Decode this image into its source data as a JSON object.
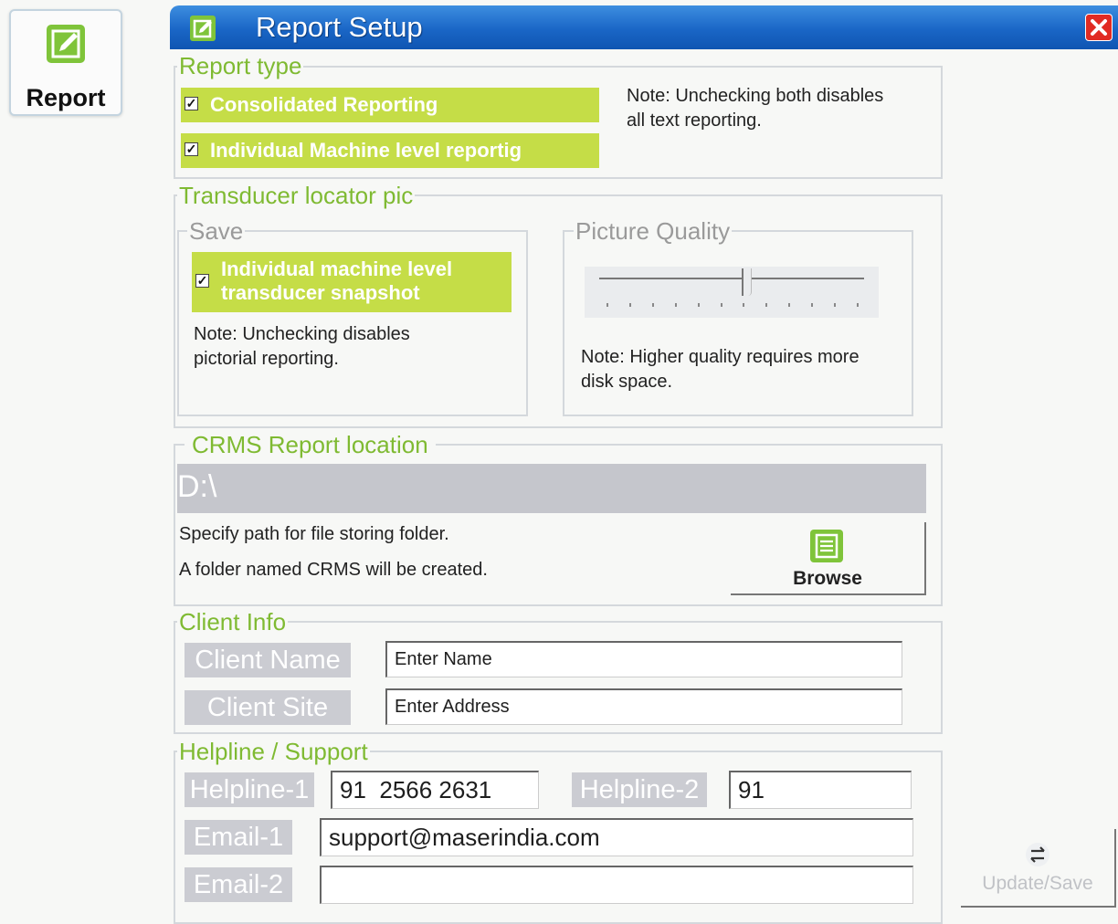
{
  "sidebar": {
    "report_label": "Report",
    "report_icon": "edit-icon"
  },
  "window": {
    "title": "Report Setup",
    "close_icon": "close-icon"
  },
  "report_type": {
    "legend": "Report type",
    "options": [
      {
        "label": "Consolidated Reporting",
        "checked": true
      },
      {
        "label": "Individual Machine level reportig",
        "checked": true
      }
    ],
    "note": [
      "Note: Unchecking both disables",
      "all text reporting."
    ]
  },
  "transducer": {
    "legend": "Transducer locator pic",
    "save": {
      "legend": "Save",
      "option_lines": [
        "Individual machine level",
        "transducer snapshot"
      ],
      "checked": true,
      "note": [
        "Note: Unchecking disables",
        "pictorial reporting."
      ]
    },
    "quality": {
      "legend": "Picture Quality",
      "level_percent": 55,
      "tick_count": 12,
      "note": [
        "Note: Higher quality requires more",
        "disk space."
      ]
    }
  },
  "crms": {
    "legend": "CRMS Report location",
    "path": "D:\\",
    "hint_1": "Specify path for file storing folder.",
    "hint_2": "A folder named CRMS will be created.",
    "browse_label": "Browse"
  },
  "client": {
    "legend": "Client Info",
    "name_label": "Client Name",
    "name_value": "Enter Name",
    "site_label": "Client Site",
    "site_value": "Enter Address"
  },
  "support": {
    "legend": "Helpline / Support",
    "helpline1_label": "Helpline-1",
    "helpline1_value": "91  2566 2631",
    "helpline2_label": "Helpline-2",
    "helpline2_value": "91",
    "email1_label": "Email-1",
    "email1_value": "support@maserindia.com",
    "email2_label": "Email-2",
    "email2_value": ""
  },
  "footer": {
    "update_label": "Update/Save"
  },
  "colors": {
    "accent_green": "#7fba32",
    "highlight_green": "#c5dd47",
    "titlebar_blue": "#1a66c6",
    "close_red": "#e12b23",
    "field_grey": "#c5c6cc"
  }
}
